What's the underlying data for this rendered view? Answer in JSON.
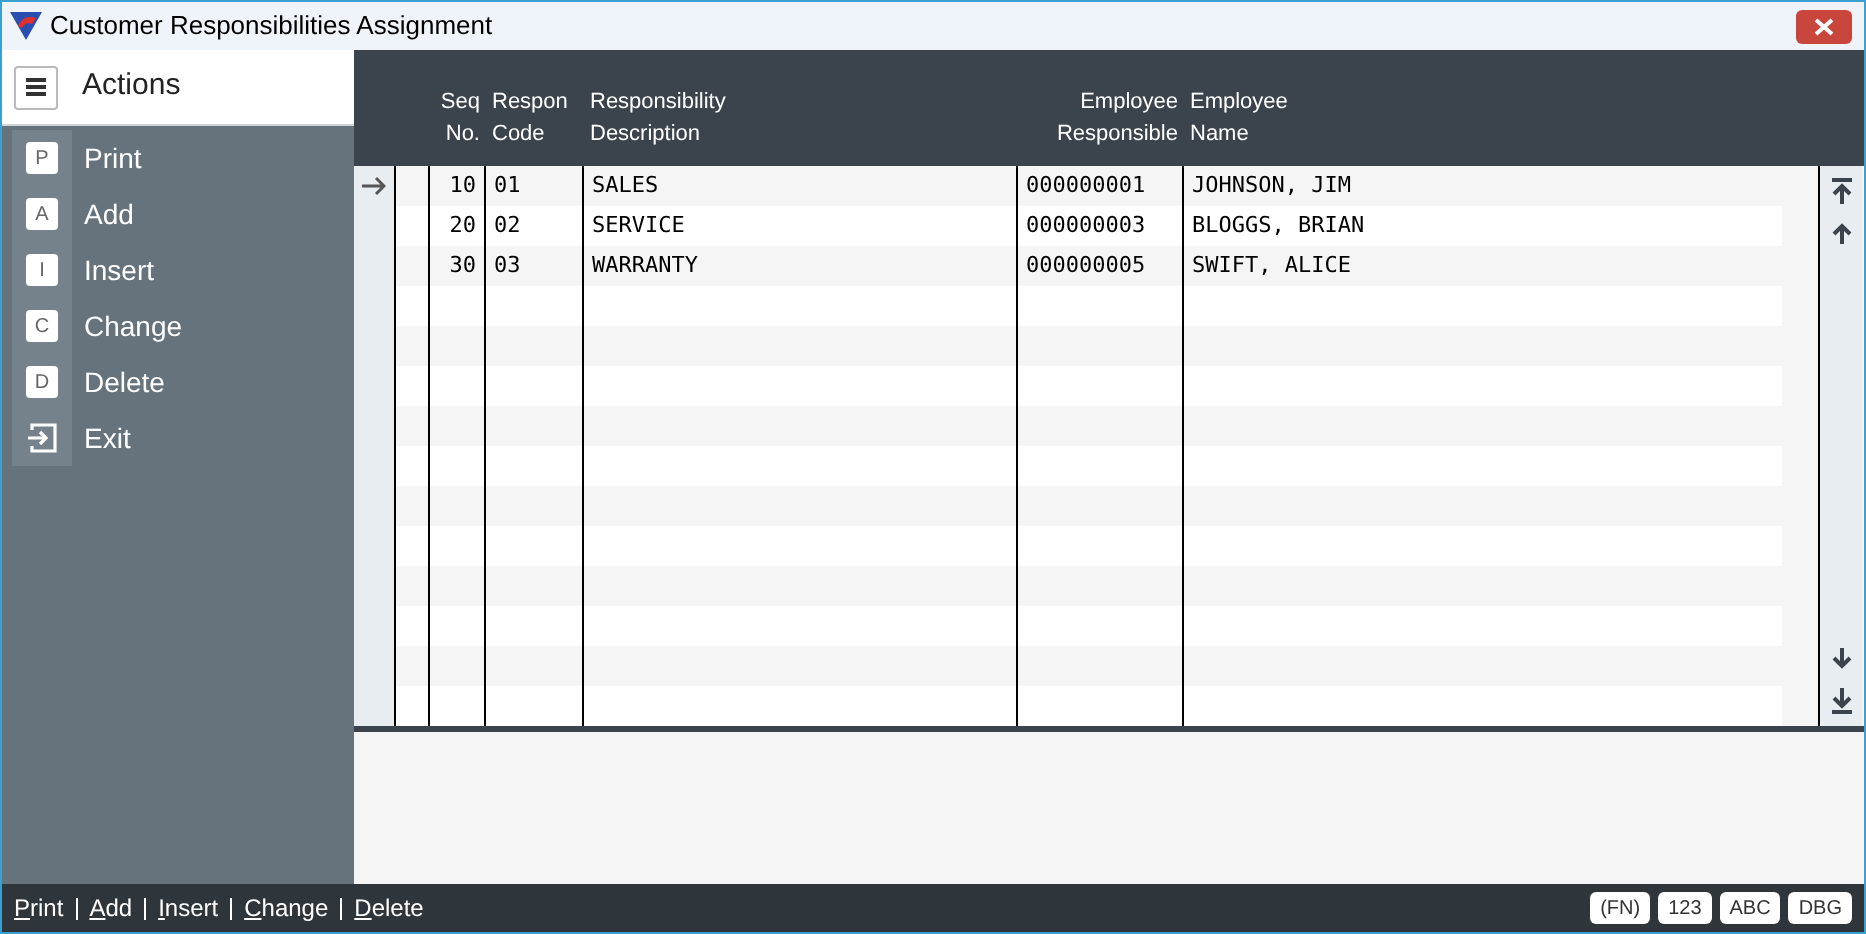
{
  "window": {
    "title": "Customer Responsibilities Assignment"
  },
  "sidebar": {
    "title": "Actions",
    "items": [
      {
        "kind": "key",
        "key": "P",
        "label": "Print"
      },
      {
        "kind": "key",
        "key": "A",
        "label": "Add"
      },
      {
        "kind": "key",
        "key": "I",
        "label": "Insert"
      },
      {
        "kind": "key",
        "key": "C",
        "label": "Change"
      },
      {
        "kind": "key",
        "key": "D",
        "label": "Delete"
      },
      {
        "kind": "icon",
        "label": "Exit"
      }
    ]
  },
  "table": {
    "columns": [
      {
        "lines": [
          "Seq",
          "No."
        ]
      },
      {
        "lines": [
          "Respon",
          "Code"
        ]
      },
      {
        "lines": [
          "Responsibility",
          "Description"
        ]
      },
      {
        "lines": [
          "Employee",
          "Responsible"
        ]
      },
      {
        "lines": [
          "Employee",
          "Name"
        ]
      }
    ],
    "rows": [
      {
        "selected": true,
        "cells": [
          "10",
          "01",
          "SALES",
          "000000001",
          "JOHNSON, JIM"
        ]
      },
      {
        "selected": false,
        "cells": [
          "20",
          "02",
          "SERVICE",
          "000000003",
          "BLOGGS, BRIAN"
        ]
      },
      {
        "selected": false,
        "cells": [
          "30",
          "03",
          "WARRANTY",
          "000000005",
          "SWIFT, ALICE"
        ]
      }
    ]
  },
  "status_bar": {
    "links": [
      "Print",
      "Add",
      "Insert",
      "Change",
      "Delete"
    ],
    "badges": [
      "(FN)",
      "123",
      "ABC",
      "DBG"
    ]
  }
}
